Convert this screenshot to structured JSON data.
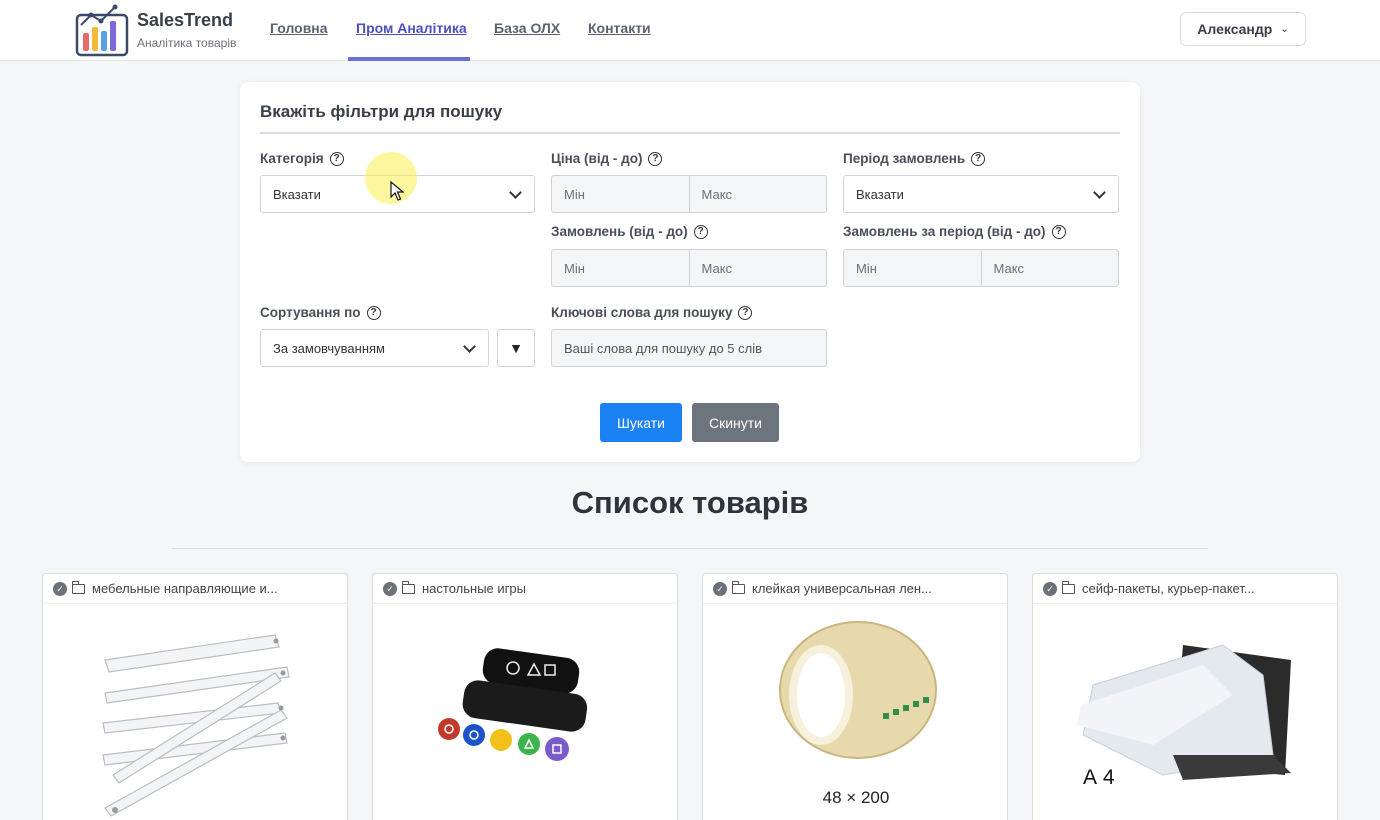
{
  "brand": {
    "name": "SalesTrend",
    "subtitle": "Аналітика товарів"
  },
  "nav": {
    "items": [
      {
        "label": "Головна",
        "active": false
      },
      {
        "label": "Пром Аналітика",
        "active": true
      },
      {
        "label": "База ОЛХ",
        "active": false
      },
      {
        "label": "Контакти",
        "active": false
      }
    ]
  },
  "user": {
    "name": "Александр"
  },
  "filters": {
    "title": "Вкажіть фільтри для пошуку",
    "category": {
      "label": "Категорія",
      "value": "Вказати"
    },
    "price": {
      "label": "Ціна (від - до)",
      "min_placeholder": "Мін",
      "max_placeholder": "Макс"
    },
    "period": {
      "label": "Період замовлень",
      "value": "Вказати"
    },
    "orders": {
      "label": "Замовлень (від - до)",
      "min_placeholder": "Мін",
      "max_placeholder": "Макс"
    },
    "orders_period": {
      "label": "Замовлень за період (від - до)",
      "min_placeholder": "Мін",
      "max_placeholder": "Макс"
    },
    "sort": {
      "label": "Сортування по",
      "value": "За замовчуванням",
      "direction_icon": "▼"
    },
    "keywords": {
      "label": "Ключові слова для пошуку",
      "placeholder": "Ваші слова для пошуку до 5 слів"
    },
    "search_button": "Шукати",
    "reset_button": "Скинути"
  },
  "products_section": {
    "title": "Список товарів",
    "items": [
      {
        "category": "мебельные направляющие и...",
        "image_text": ""
      },
      {
        "category": "настольные игры",
        "image_text": ""
      },
      {
        "category": "клейкая универсальная лен...",
        "image_text": "48  ×  200"
      },
      {
        "category": "сейф-пакеты, курьер-пакет...",
        "image_text": "А 4"
      }
    ]
  },
  "colors": {
    "accent": "#6b6fd4",
    "primary_button": "#1a82f5",
    "secondary_button": "#6c757d"
  }
}
